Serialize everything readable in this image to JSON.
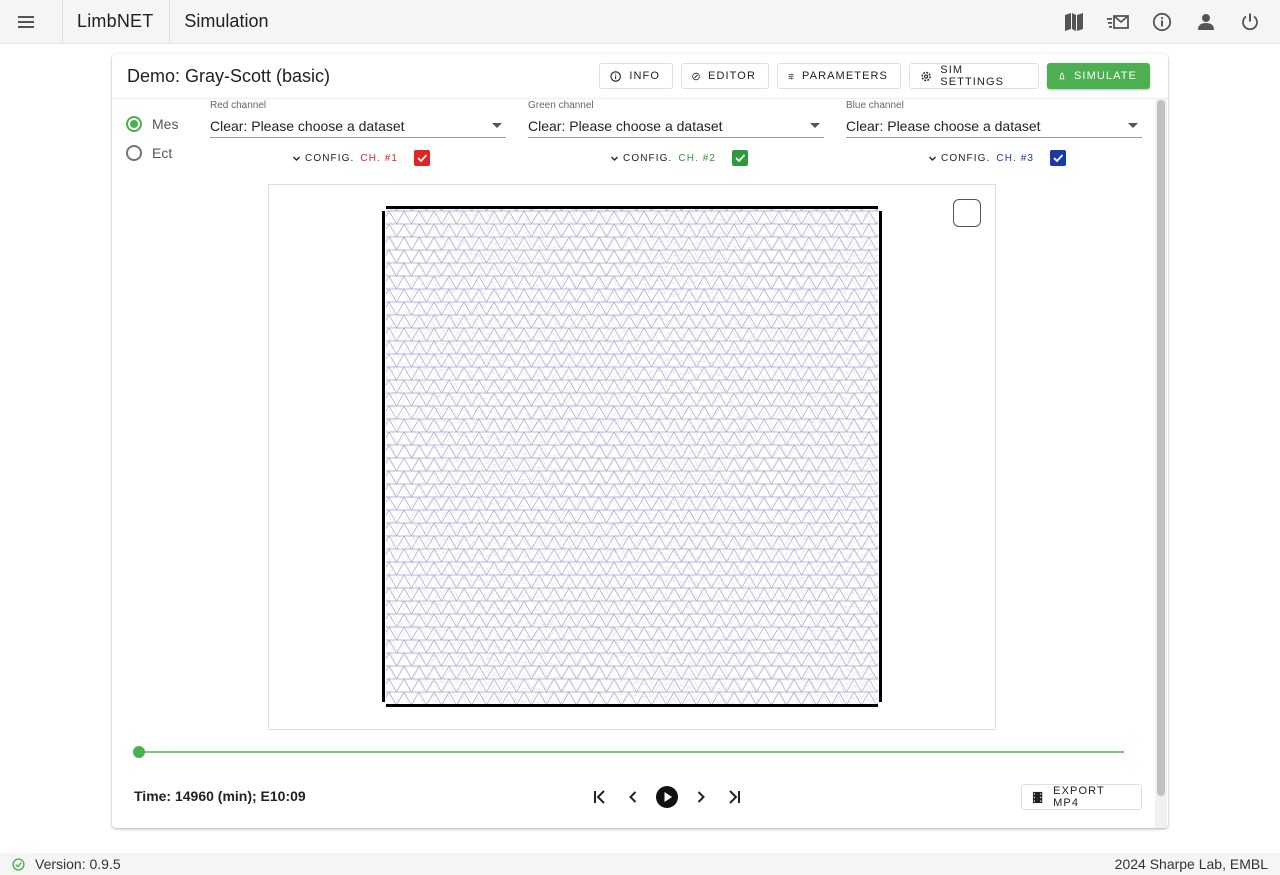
{
  "app": {
    "name": "LimbNET",
    "section": "Simulation"
  },
  "appbar_icons": [
    "menu-icon",
    "book-icon",
    "mail-icon",
    "info-icon",
    "account-icon",
    "power-icon"
  ],
  "demo": {
    "title": "Demo: Gray-Scott (basic)"
  },
  "actions": {
    "info": "INFO",
    "editor": "EDITOR",
    "parameters": "PARAMETERS",
    "sim_settings": "SIM SETTINGS",
    "simulate": "SIMULATE"
  },
  "tissue": {
    "options": [
      "Mes",
      "Ect"
    ],
    "selected": "Mes"
  },
  "channels": [
    {
      "label": "Red channel",
      "value": "Clear: Please choose a dataset",
      "config": "CONFIG.",
      "ch": "CH. #1",
      "color": "#e02424",
      "checked": true
    },
    {
      "label": "Green channel",
      "value": "Clear: Please choose a dataset",
      "config": "CONFIG.",
      "ch": "CH. #2",
      "color": "#2e9a3c",
      "checked": true
    },
    {
      "label": "Blue channel",
      "value": "Clear: Please choose a dataset",
      "config": "CONFIG.",
      "ch": "CH. #3",
      "color": "#1a3aa8",
      "checked": true
    }
  ],
  "colors": {
    "accent": "#4caf50",
    "mesh": "#a4a6d4"
  },
  "timeline": {
    "progress": 0.0
  },
  "time": {
    "label": "Time: 14960 (min); E10:09"
  },
  "export": {
    "label": "EXPORT MP4"
  },
  "footer": {
    "version": "Version: 0.9.5",
    "credit": "2024 Sharpe Lab, EMBL"
  }
}
